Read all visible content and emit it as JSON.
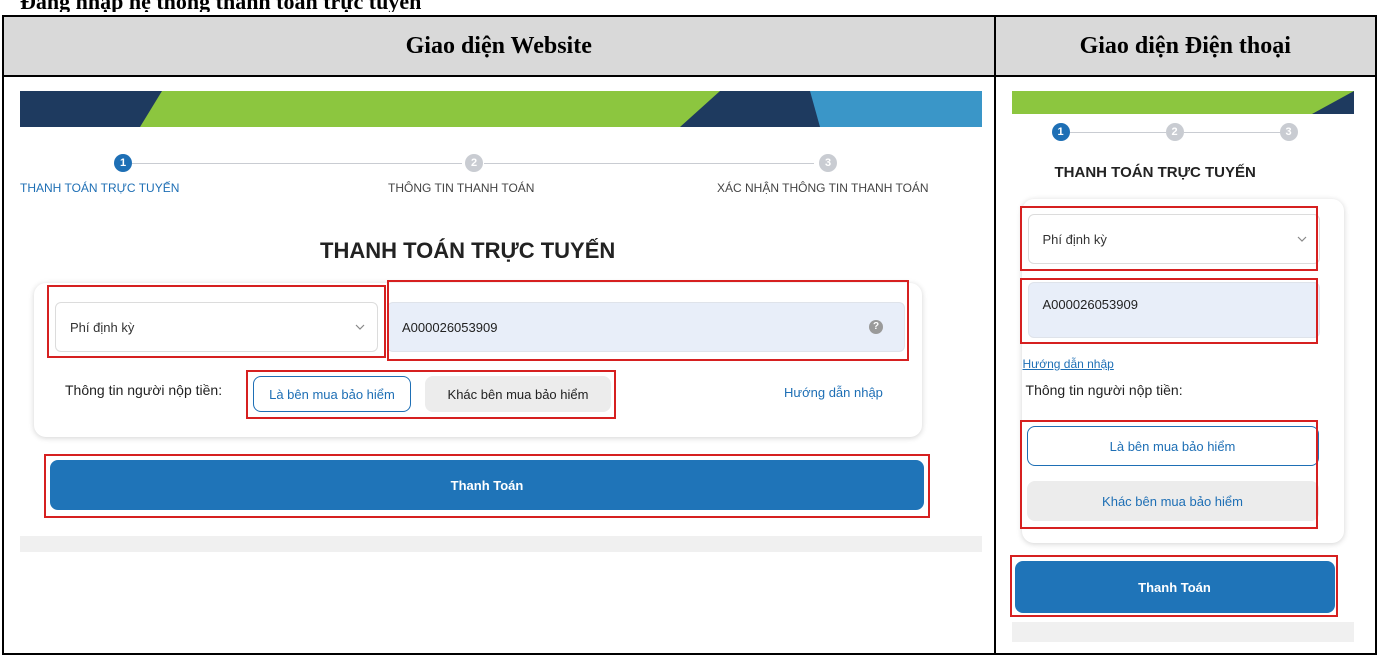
{
  "header": {
    "web_title": "Giao diện Website",
    "mobile_title": "Giao diện Điện thoại"
  },
  "web": {
    "steps": [
      {
        "number": "1",
        "label": "THANH TOÁN TRỰC TUYẾN"
      },
      {
        "number": "2",
        "label": "THÔNG TIN THANH TOÁN"
      },
      {
        "number": "3",
        "label": "XÁC NHẬN THÔNG TIN THANH TOÁN"
      }
    ],
    "page_title": "THANH TOÁN TRỰC TUYẾN",
    "fee_select_value": "Phí định kỳ",
    "contract_input_value": "A000026053909",
    "help_icon": "?",
    "payer_label": "Thông tin người nộp tiền:",
    "option_buyer": "Là bên mua bảo hiểm",
    "option_other": "Khác bên mua bảo hiểm",
    "help_link": "Hướng dẫn nhập",
    "pay_button": "Thanh Toán"
  },
  "mobile": {
    "steps": [
      {
        "number": "1"
      },
      {
        "number": "2"
      },
      {
        "number": "3"
      }
    ],
    "page_title": "THANH TOÁN TRỰC TUYẾN",
    "fee_select_value": "Phí định kỳ",
    "contract_input_value": "A000026053909",
    "help_link": "Hướng dẫn nhập",
    "payer_label": "Thông tin người nộp tiền:",
    "option_buyer": "Là bên mua bảo hiểm",
    "option_other": "Khác bên mua bảo hiểm",
    "pay_button": "Thanh Toán"
  },
  "colors": {
    "primary": "#1f74b8",
    "highlight_border": "#d62020",
    "banner_dark": "#1e3a5f",
    "banner_green": "#8cc63f",
    "banner_teal": "#3a96c8"
  }
}
